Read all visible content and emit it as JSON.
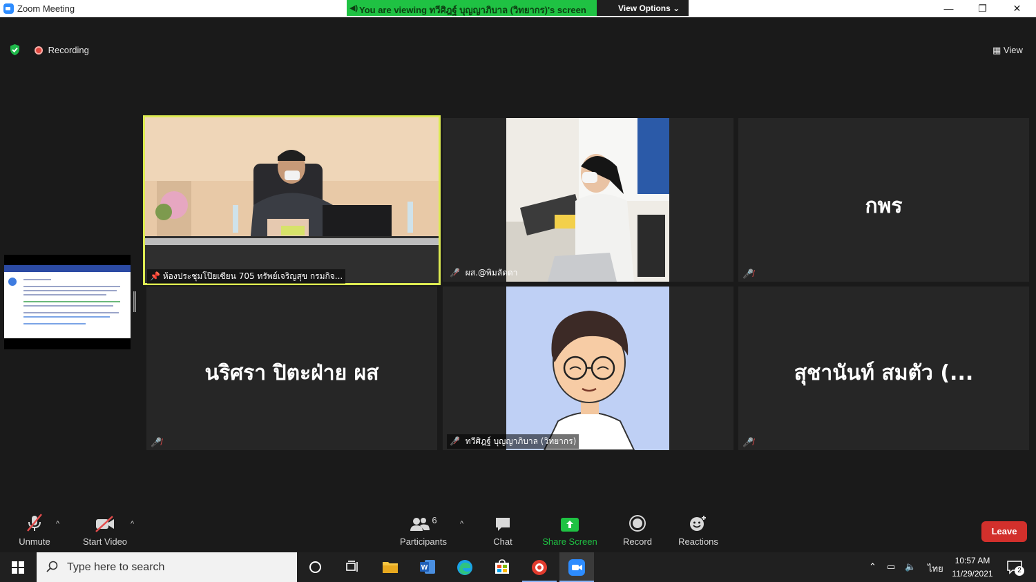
{
  "window": {
    "title": "Zoom Meeting",
    "share_banner": "You are viewing ทวีศิฎฐ์ บุญญาภิบาล (วิทยากร)'s screen",
    "view_options": "View Options",
    "minimize": "—",
    "restore": "❐",
    "close": "✕"
  },
  "meeting": {
    "recording_label": "Recording",
    "view_label": "View"
  },
  "tiles": [
    {
      "id": "room705",
      "label": "ห้องประชุมโป๊ยเซียน 705 ทรัพย์เจริญสุข กรมกิจ...",
      "has_video": true,
      "active": true
    },
    {
      "id": "pimlada",
      "label": "ผส.@พิมลัดดา",
      "has_video": true,
      "muted": true
    },
    {
      "id": "kpr",
      "display_name": "กพร",
      "muted": true
    },
    {
      "id": "narisara",
      "display_name": "นริศรา ปิตะฝ่าย ผส",
      "muted": true
    },
    {
      "id": "taweesit",
      "label": "ทวีศิฎฐ์ บุญญาภิบาล (วิทยากร)",
      "has_video": true,
      "muted": true
    },
    {
      "id": "suchanan",
      "display_name": "สุชานันท์ สมตัว (...",
      "muted": true
    }
  ],
  "toolbar": {
    "unmute": "Unmute",
    "start_video": "Start Video",
    "participants": "Participants",
    "participant_count": "6",
    "chat": "Chat",
    "share_screen": "Share Screen",
    "record": "Record",
    "reactions": "Reactions",
    "leave": "Leave"
  },
  "taskbar": {
    "search_placeholder": "Type here to search",
    "lang": "ไทย",
    "time": "10:57 AM",
    "date": "11/29/2021",
    "notifications": "2"
  },
  "colors": {
    "share_green": "#1fc243",
    "active_speaker": "#ddeb52",
    "leave_red": "#d2302c",
    "mute_red": "#e34b4b",
    "zoom_blue": "#2d8cff"
  }
}
